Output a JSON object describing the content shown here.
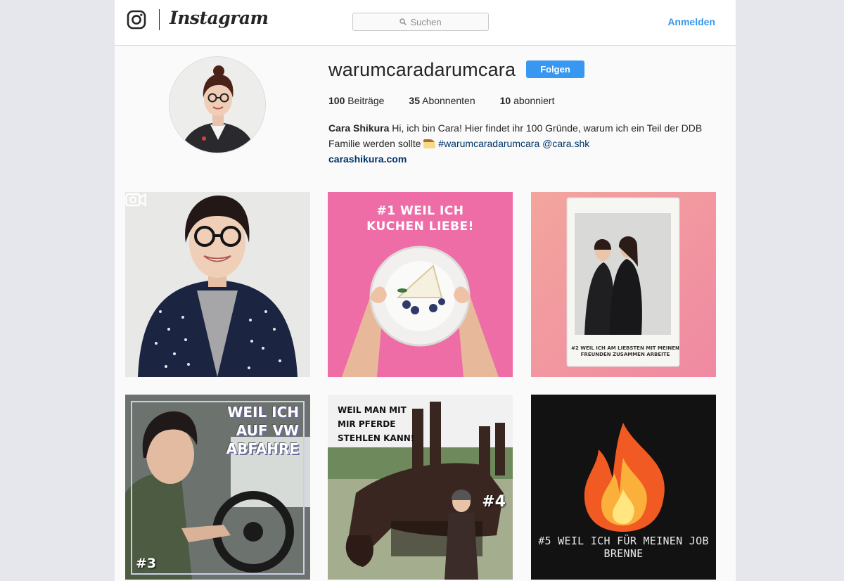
{
  "header": {
    "brand": "Instagram",
    "search_placeholder": "Suchen",
    "login_label": "Anmelden"
  },
  "profile": {
    "username": "warumcaradarumcara",
    "follow_label": "Folgen",
    "stats": [
      {
        "count": "100",
        "label": "Beiträge"
      },
      {
        "count": "35",
        "label": "Abonnenten"
      },
      {
        "count": "10",
        "label": "abonniert"
      }
    ],
    "full_name": "Cara Shikura",
    "bio_text": "Hi, ich bin Cara! Hier findet ihr 100 Gründe, warum ich ein Teil der DDB Familie werden sollte",
    "hashtag": "#warumcaradarumcara",
    "mention": "@cara.shk",
    "website": "carashikura.com"
  },
  "posts": [
    {
      "kind": "video",
      "caption": ""
    },
    {
      "kind": "image",
      "caption_line1": "#1 WEIL ICH",
      "caption_line2": "KUCHEN LIEBE!"
    },
    {
      "kind": "image",
      "caption_line1": "#2 WEIL ICH AM LIEBSTEN MIT MEINEN",
      "caption_line2": "FREUNDEN ZUSAMMEN ARBEITE"
    },
    {
      "kind": "image",
      "caption_line1": "WEIL ICH",
      "caption_line2": "AUF VW",
      "caption_line3": "ABFAHRE",
      "number": "#3"
    },
    {
      "kind": "image",
      "caption_line1": "WEIL MAN MIT",
      "caption_line2": "MIR PFERDE",
      "caption_line3": "STEHLEN KANN!",
      "number": "#4"
    },
    {
      "kind": "image",
      "caption": "#5 WEIL ICH FÜR MEINEN JOB BRENNE"
    }
  ],
  "colors": {
    "accent": "#3897f0",
    "link": "#003569",
    "background": "#fafafa"
  }
}
